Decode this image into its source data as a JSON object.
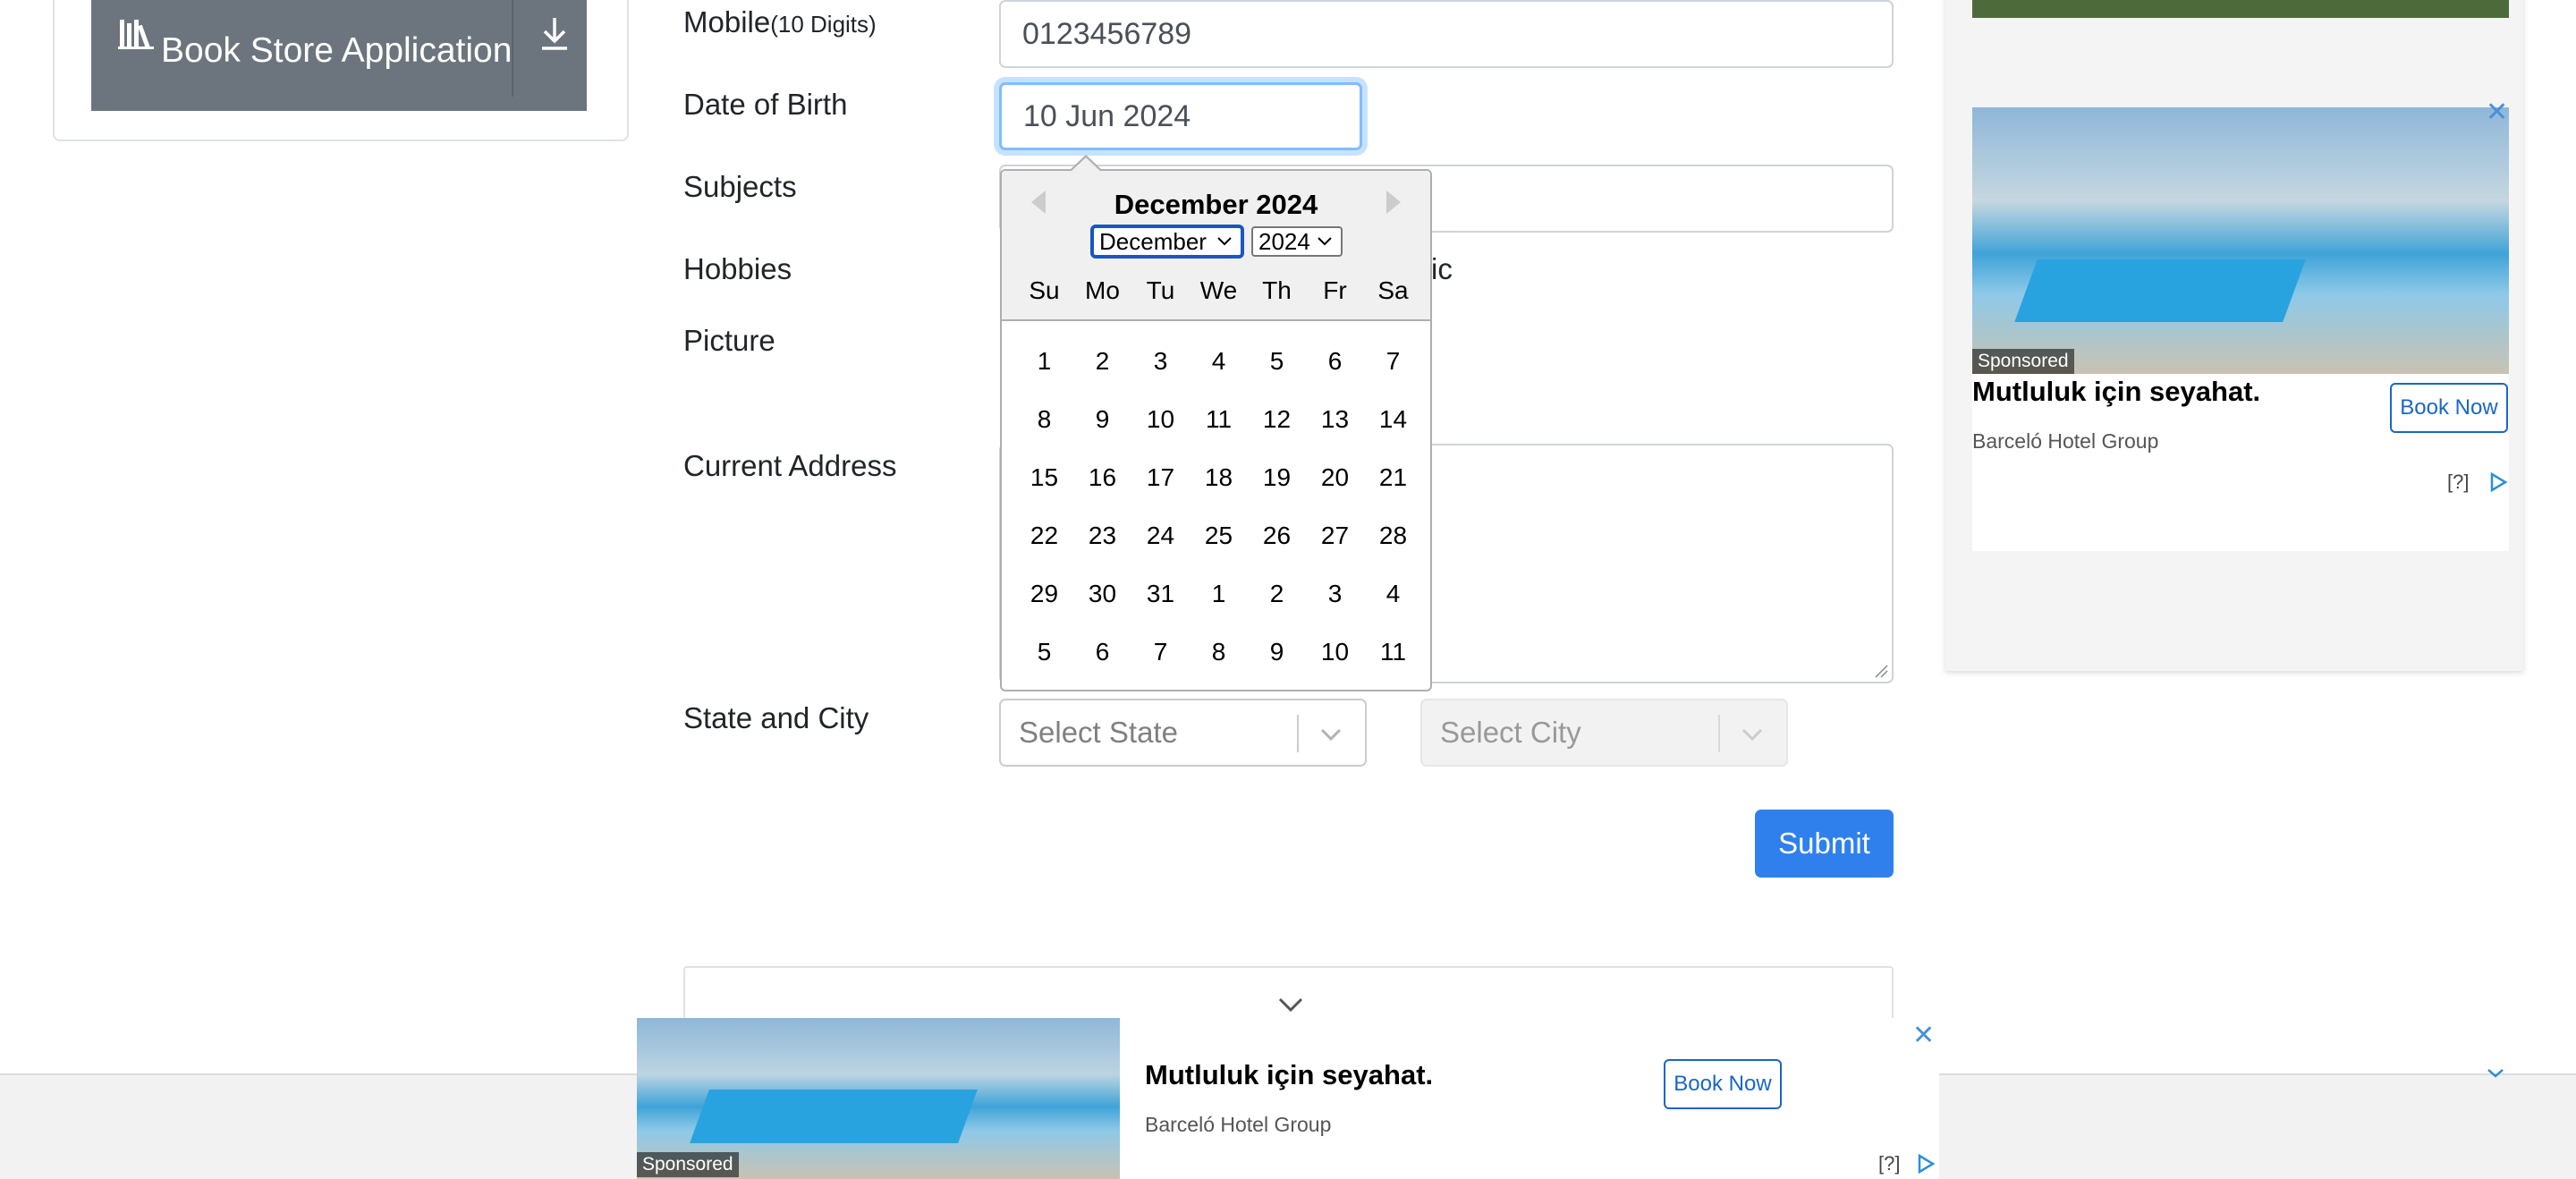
{
  "sidebar": {
    "book_store_label": "Book Store Application",
    "library_icon": "library-icon",
    "download_icon": "download-icon"
  },
  "form": {
    "mobile_label": "Mobile",
    "mobile_hint": "(10 Digits)",
    "mobile_value": "0123456789",
    "dob_label": "Date of Birth",
    "dob_value": "10 Jun 2024",
    "subjects_label": "Subjects",
    "hobbies_label": "Hobbies",
    "hobbies_partial": "ic",
    "picture_label": "Picture",
    "address_label": "Current Address",
    "state_city_label": "State and City",
    "state_placeholder": "Select State",
    "city_placeholder": "Select City",
    "submit_label": "Submit"
  },
  "datepicker": {
    "title": "December 2024",
    "month_selected": "December",
    "year_selected": "2024",
    "day_names": [
      "Su",
      "Mo",
      "Tu",
      "We",
      "Th",
      "Fr",
      "Sa"
    ],
    "weeks": [
      [
        "1",
        "2",
        "3",
        "4",
        "5",
        "6",
        "7"
      ],
      [
        "8",
        "9",
        "10",
        "11",
        "12",
        "13",
        "14"
      ],
      [
        "15",
        "16",
        "17",
        "18",
        "19",
        "20",
        "21"
      ],
      [
        "22",
        "23",
        "24",
        "25",
        "26",
        "27",
        "28"
      ],
      [
        "29",
        "30",
        "31",
        "1",
        "2",
        "3",
        "4"
      ],
      [
        "5",
        "6",
        "7",
        "8",
        "9",
        "10",
        "11"
      ]
    ]
  },
  "ad_right": {
    "sponsored": "Sponsored",
    "headline": "Mutluluk için seyahat.",
    "advertiser": "Barceló Hotel Group",
    "cta": "Book Now",
    "info": "[?]",
    "close": "✕"
  },
  "ad_bottom": {
    "sponsored": "Sponsored",
    "headline": "Mutluluk için seyahat.",
    "advertiser": "Barceló Hotel Group",
    "cta": "Book Now",
    "info": "[?]",
    "close": "✕"
  },
  "colors": {
    "primary": "#2f80ed",
    "secondary": "#6c757d",
    "focus": "#80bdff"
  }
}
